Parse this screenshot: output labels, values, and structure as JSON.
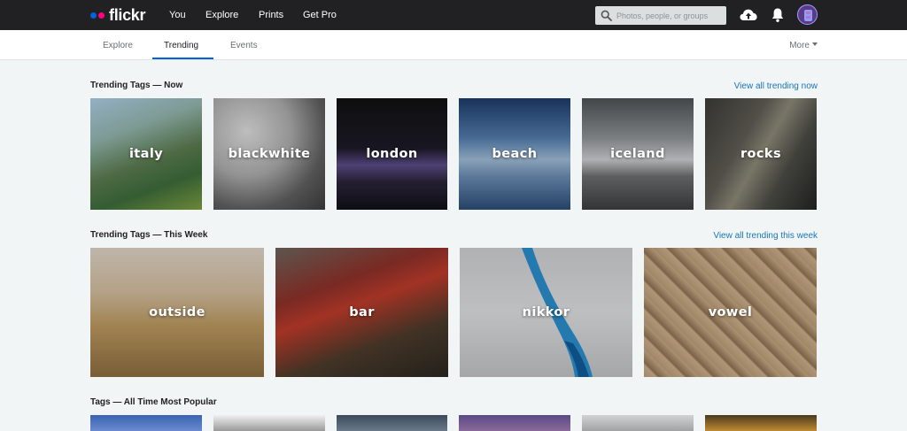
{
  "header": {
    "logo_text": "flickr",
    "nav": [
      "You",
      "Explore",
      "Prints",
      "Get Pro"
    ],
    "search_placeholder": "Photos, people, or groups"
  },
  "subnav": {
    "tabs": [
      "Explore",
      "Trending",
      "Events"
    ],
    "active_tab": "Trending",
    "more_label": "More"
  },
  "sections": {
    "now": {
      "title": "Trending Tags — Now",
      "view_all": "View all trending now",
      "tags": [
        "italy",
        "blackwhite",
        "london",
        "beach",
        "iceland",
        "rocks"
      ]
    },
    "week": {
      "title": "Trending Tags — This Week",
      "view_all": "View all trending this week",
      "tags": [
        "outside",
        "bar",
        "nikkor",
        "vowel"
      ]
    },
    "alltime": {
      "title": "Tags — All Time Most Popular"
    }
  },
  "colors": {
    "topbar": "#212124",
    "accent_blue": "#0063dc",
    "accent_pink": "#ff0084",
    "link": "#1876b5",
    "page_bg": "#f2f5f6"
  }
}
